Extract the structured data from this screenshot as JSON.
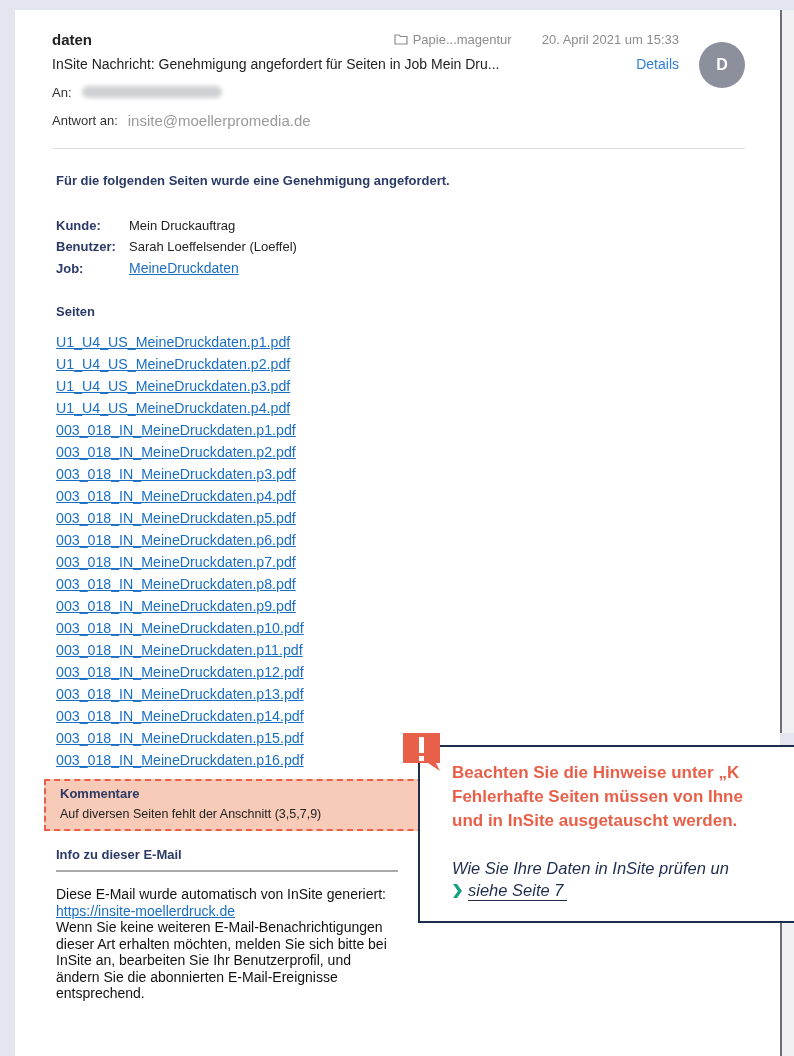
{
  "header": {
    "sender": "daten",
    "folder": "Papie...magentur",
    "date": "20. April 2021 um 15:33",
    "avatar": "D",
    "subject": "InSite Nachricht: Genehmigung angefordert für Seiten in Job Mein Dru...",
    "details": "Details",
    "to_label": "An:",
    "reply_to_label": "Antwort an:",
    "reply_to": "insite@moellerpromedia.de"
  },
  "body": {
    "heading": "Für die folgenden Seiten wurde eine Genehmigung angefordert.",
    "fields": [
      {
        "label": "Kunde:",
        "value": "Mein Druckauftrag",
        "kind": "text"
      },
      {
        "label": "Benutzer:",
        "value": "Sarah Loeffelsender (Loeffel)",
        "kind": "text"
      },
      {
        "label": "Job:",
        "value": "MeineDruckdaten",
        "kind": "link"
      }
    ],
    "pages_heading": "Seiten",
    "pages": [
      "U1_U4_US_MeineDruckdaten.p1.pdf",
      "U1_U4_US_MeineDruckdaten.p2.pdf",
      "U1_U4_US_MeineDruckdaten.p3.pdf",
      "U1_U4_US_MeineDruckdaten.p4.pdf",
      "003_018_IN_MeineDruckdaten.p1.pdf",
      "003_018_IN_MeineDruckdaten.p2.pdf",
      "003_018_IN_MeineDruckdaten.p3.pdf",
      "003_018_IN_MeineDruckdaten.p4.pdf",
      "003_018_IN_MeineDruckdaten.p5.pdf",
      "003_018_IN_MeineDruckdaten.p6.pdf",
      "003_018_IN_MeineDruckdaten.p7.pdf",
      "003_018_IN_MeineDruckdaten.p8.pdf",
      "003_018_IN_MeineDruckdaten.p9.pdf",
      "003_018_IN_MeineDruckdaten.p10.pdf",
      "003_018_IN_MeineDruckdaten.p11.pdf",
      "003_018_IN_MeineDruckdaten.p12.pdf",
      "003_018_IN_MeineDruckdaten.p13.pdf",
      "003_018_IN_MeineDruckdaten.p14.pdf",
      "003_018_IN_MeineDruckdaten.p15.pdf",
      "003_018_IN_MeineDruckdaten.p16.pdf"
    ],
    "comments": {
      "title": "Kommentare",
      "text": "Auf diversen Seiten fehlt der Anschnitt (3,5,7,9)"
    },
    "info": {
      "title": "Info zu dieser E-Mail",
      "text_before": "Diese E-Mail wurde automatisch von InSite generiert: ",
      "link": "https://insite-moellerdruck.de",
      "text_after": "Wenn Sie keine weiteren E-Mail-Benachrichtigungen dieser Art erhalten möchten, melden Sie sich bitte bei InSite an, bearbeiten Sie Ihr Benutzerprofil, und ändern Sie die abonnierten E-Mail-Ereignisse entsprechend."
    }
  },
  "callout": {
    "lines": [
      "Beachten Sie die Hinweise unter „K",
      "Fehlerhafte Seiten müssen von Ihne",
      "und in InSite ausgetauscht werden."
    ],
    "note": "Wie Sie Ihre Daten in InSite prüfen un",
    "link": "siehe Seite 7"
  }
}
